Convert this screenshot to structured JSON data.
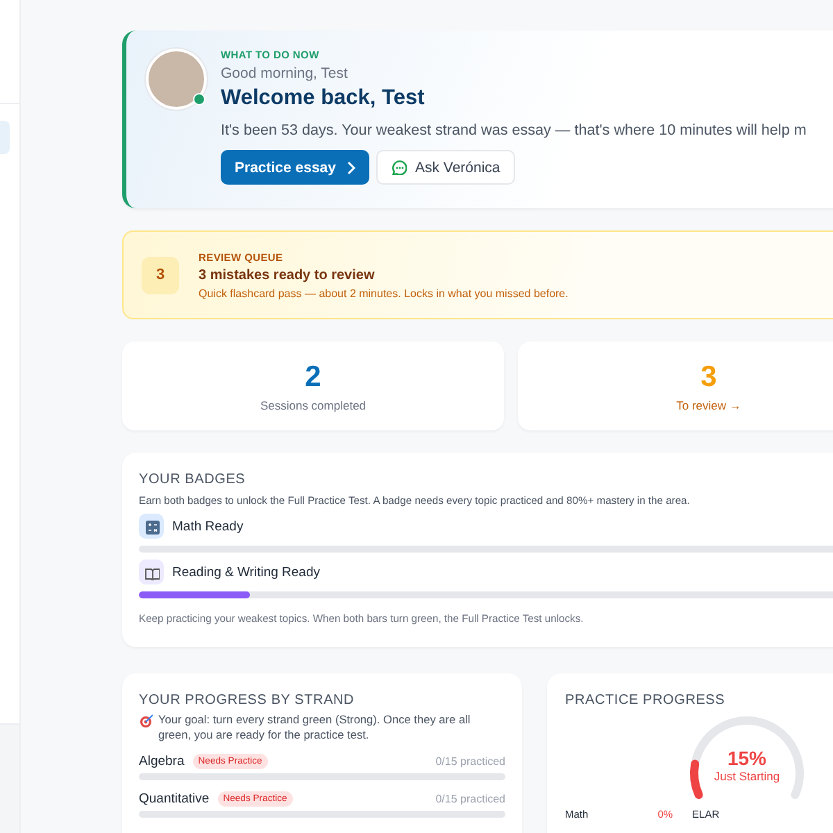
{
  "hero": {
    "eyebrow": "WHAT TO DO NOW",
    "greeting": "Good morning, Test",
    "title": "Welcome back, Test",
    "message": "It's been 53 days. Your weakest strand was essay — that's where 10 minutes will help m",
    "online": true,
    "primary_button": "Practice essay",
    "secondary_button": "Ask Verónica"
  },
  "review_queue": {
    "count": "3",
    "eyebrow": "REVIEW QUEUE",
    "title": "3 mistakes ready to review",
    "description": "Quick flashcard pass — about 2 minutes. Locks in what you missed before."
  },
  "stats": [
    {
      "value": "2",
      "label": "Sessions completed",
      "kind": "text",
      "color": "#0b6fb8"
    },
    {
      "value": "3",
      "label": "To review →",
      "kind": "link",
      "color": "#f59e0b"
    }
  ],
  "badges": {
    "title": "YOUR BADGES",
    "description": "Earn both badges to unlock the Full Practice Test. A badge needs every topic practiced and 80%+ mastery in the area.",
    "items": [
      {
        "name": "Math Ready",
        "kind": "math",
        "level": 0
      },
      {
        "name": "Reading & Writing Ready",
        "kind": "reading",
        "level": 0.15
      }
    ],
    "footer": "Keep practicing your weakest topics. When both bars turn green, the Full Practice Test unlocks."
  },
  "strands": {
    "title": "YOUR PROGRESS BY STRAND",
    "goal": "Your goal: turn every strand green (Strong). Once they are all green, you are ready for the practice test.",
    "items": [
      {
        "name": "Algebra",
        "tag": "Needs Practice",
        "practiced": "0/15 practiced",
        "level": 0
      },
      {
        "name": "Quantitative",
        "tag": "Needs Practice",
        "practiced": "0/15 practiced",
        "level": 0
      }
    ]
  },
  "practice_progress": {
    "title": "PRACTICE PROGRESS",
    "level": 0.15,
    "reading": "15%",
    "status": "Just Starting",
    "areas": [
      {
        "name": "Math",
        "value": "0%"
      },
      {
        "name": "ELAR"
      }
    ]
  }
}
